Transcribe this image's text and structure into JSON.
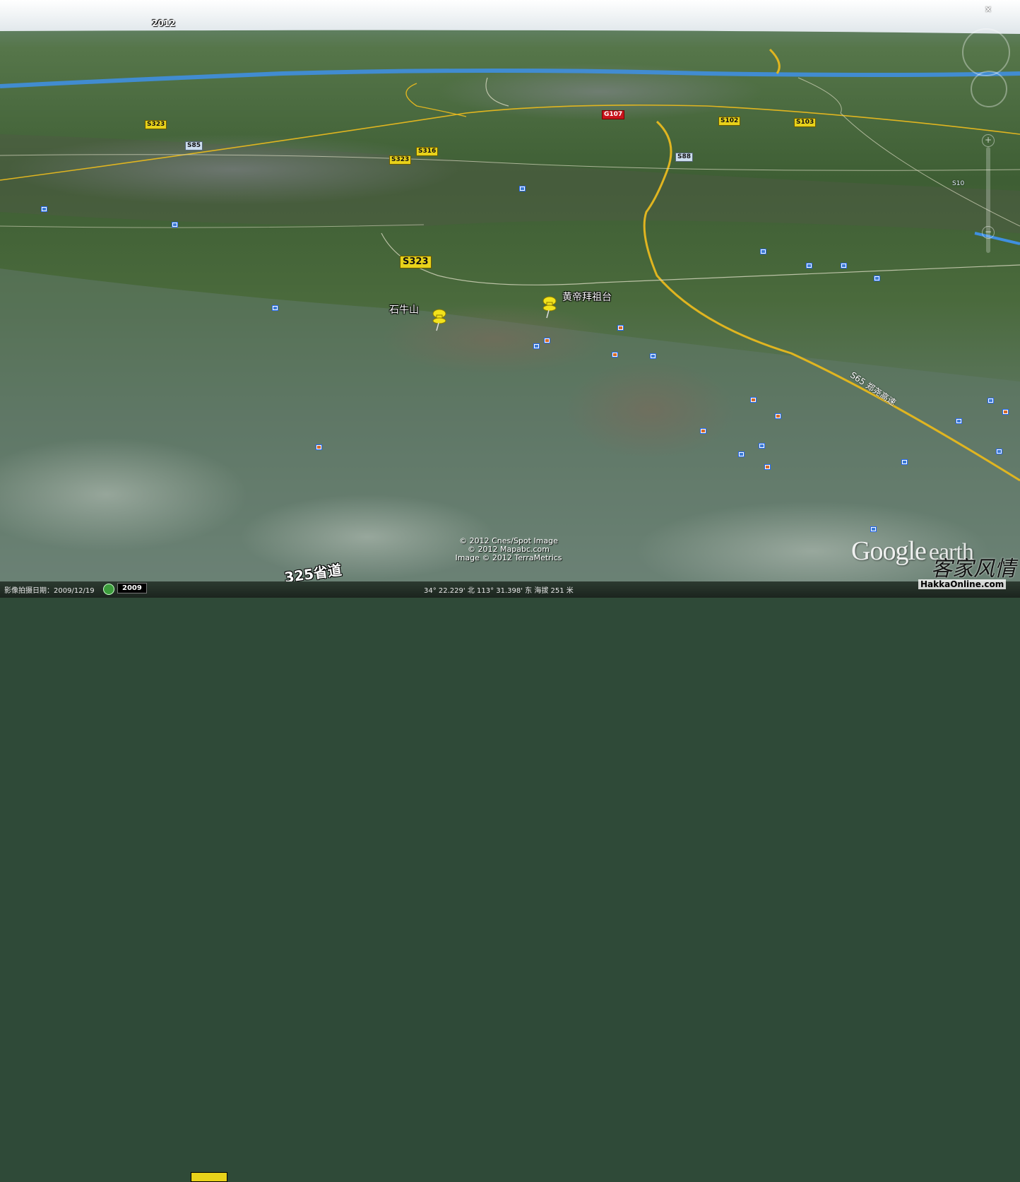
{
  "map": {
    "year_overlay": "2012",
    "placemarks": [
      {
        "name": "石牛山"
      },
      {
        "name": "黄帝拜祖台"
      }
    ],
    "road_shields": {
      "s323_main": "S323",
      "s323_small": "S323",
      "s316": "S316",
      "s85": "S85",
      "s88": "S88",
      "s323_left": "S323",
      "s10": "S10",
      "g107": "G107",
      "s102": "S102",
      "s103": "S103"
    },
    "road_label_s65": "S65 郑尧高速",
    "road_label_325": "325省道"
  },
  "credits": {
    "line1": "© 2012 Cnes/Spot Image",
    "line2": "© 2012 Mapabc.com",
    "line3": "Image © 2012 TerraMetrics"
  },
  "branding": {
    "google": "Google",
    "earth": "earth",
    "watermark_cn": "客家风情",
    "watermark_url": "HakkaOnline.com"
  },
  "statusbar": {
    "imagery_date": "影像拍摄日期：2009/12/19",
    "year_button": "2009",
    "coordinates": "34° 22.229' 北  113° 31.398' 东  海拔  251 米"
  },
  "controls": {
    "close": "×"
  },
  "colors": {
    "pin": "#f2e21c",
    "road_major": "#e0b520",
    "road_minor": "#d8d8c0",
    "river": "#3f8fe0"
  }
}
